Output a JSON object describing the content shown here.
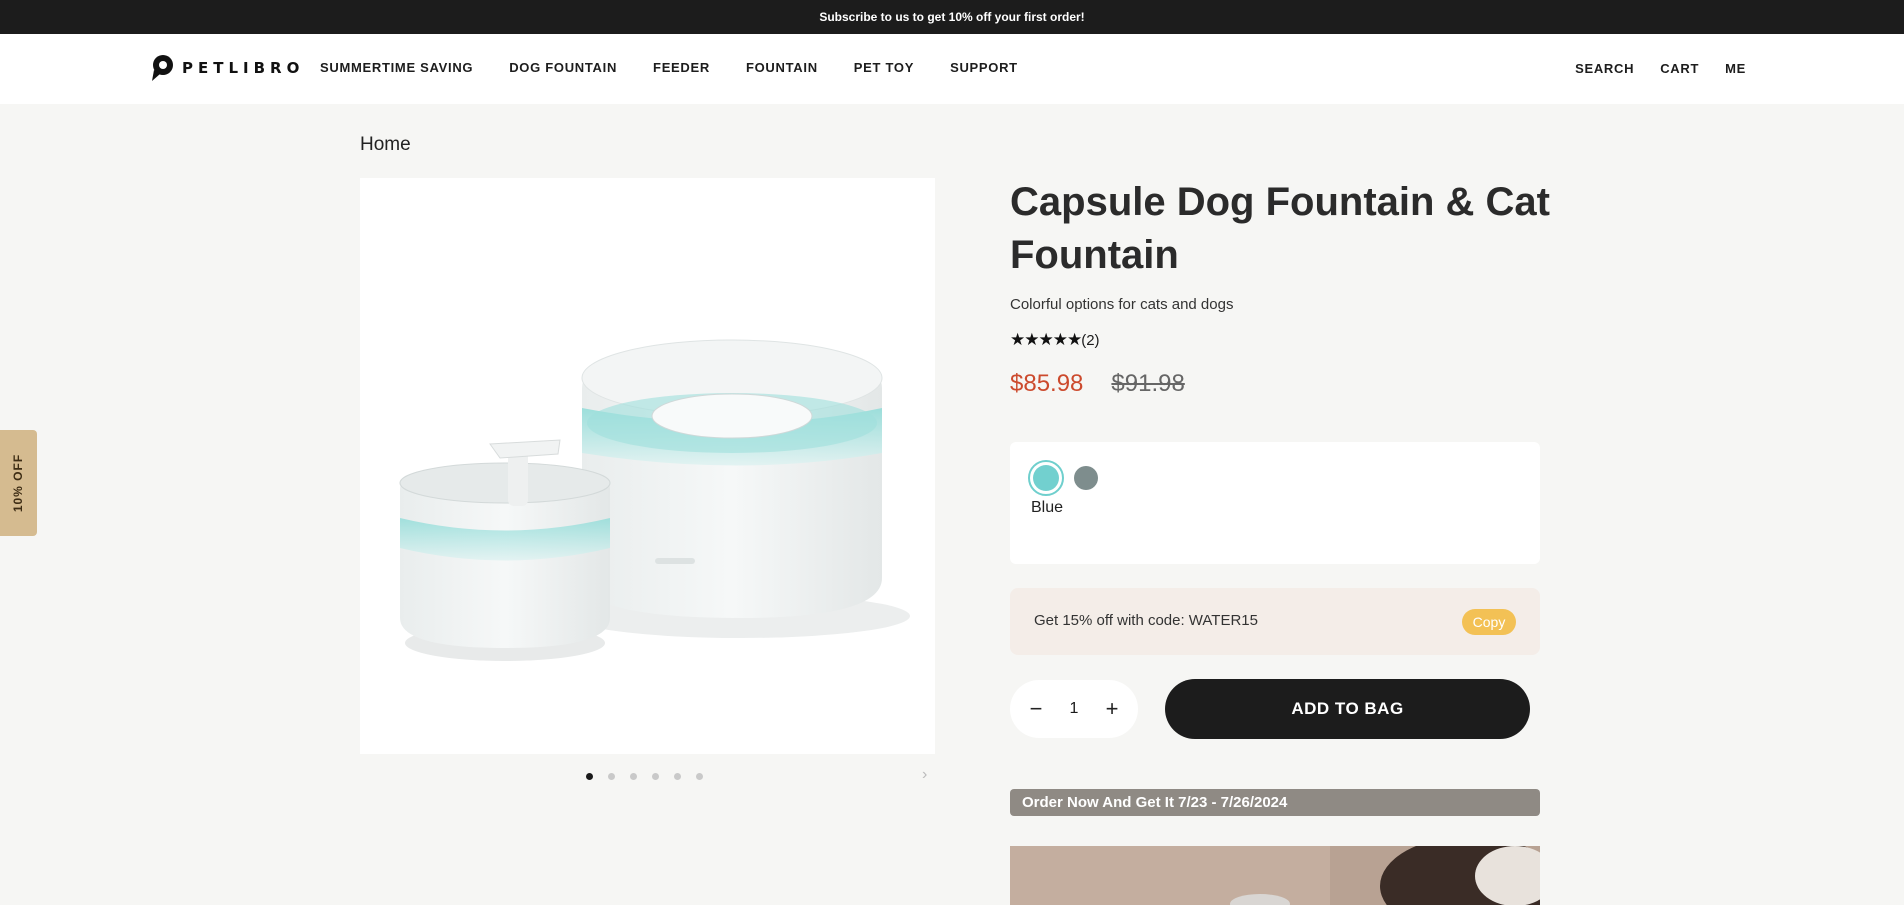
{
  "promo_bar": {
    "text": "Subscribe to us to get 10% off your first order!"
  },
  "header": {
    "logo_text": "PETLIBRO",
    "nav": [
      "SUMMERTIME SAVING",
      "DOG FOUNTAIN",
      "FEEDER",
      "FOUNTAIN",
      "PET TOY",
      "SUPPORT"
    ],
    "utility": {
      "search": "SEARCH",
      "cart": "CART",
      "account": "ME"
    }
  },
  "side_tab": {
    "label": "10% OFF"
  },
  "breadcrumb": "Home",
  "product": {
    "title": "Capsule Dog Fountain & Cat Fountain",
    "subtitle": "Colorful options for cats and dogs",
    "rating": {
      "stars": 5,
      "count_label": "(2)"
    },
    "price": {
      "sale": "$85.98",
      "original": "$91.98"
    },
    "variant": {
      "selected_name": "Blue",
      "options": [
        {
          "name": "Blue",
          "color": "#72d0cf"
        },
        {
          "name": "Gray",
          "color": "#7e8d8d"
        }
      ]
    },
    "coupon": {
      "text": "Get 15% off with code: WATER15",
      "button": "Copy"
    },
    "quantity": {
      "value": "1",
      "minus": "−",
      "plus": "+"
    },
    "add_to_bag": "ADD TO BAG",
    "order_banner": "Order Now And Get It 7/23 - 7/26/2024"
  },
  "gallery": {
    "slide_count": 6,
    "active_slide": 1
  }
}
